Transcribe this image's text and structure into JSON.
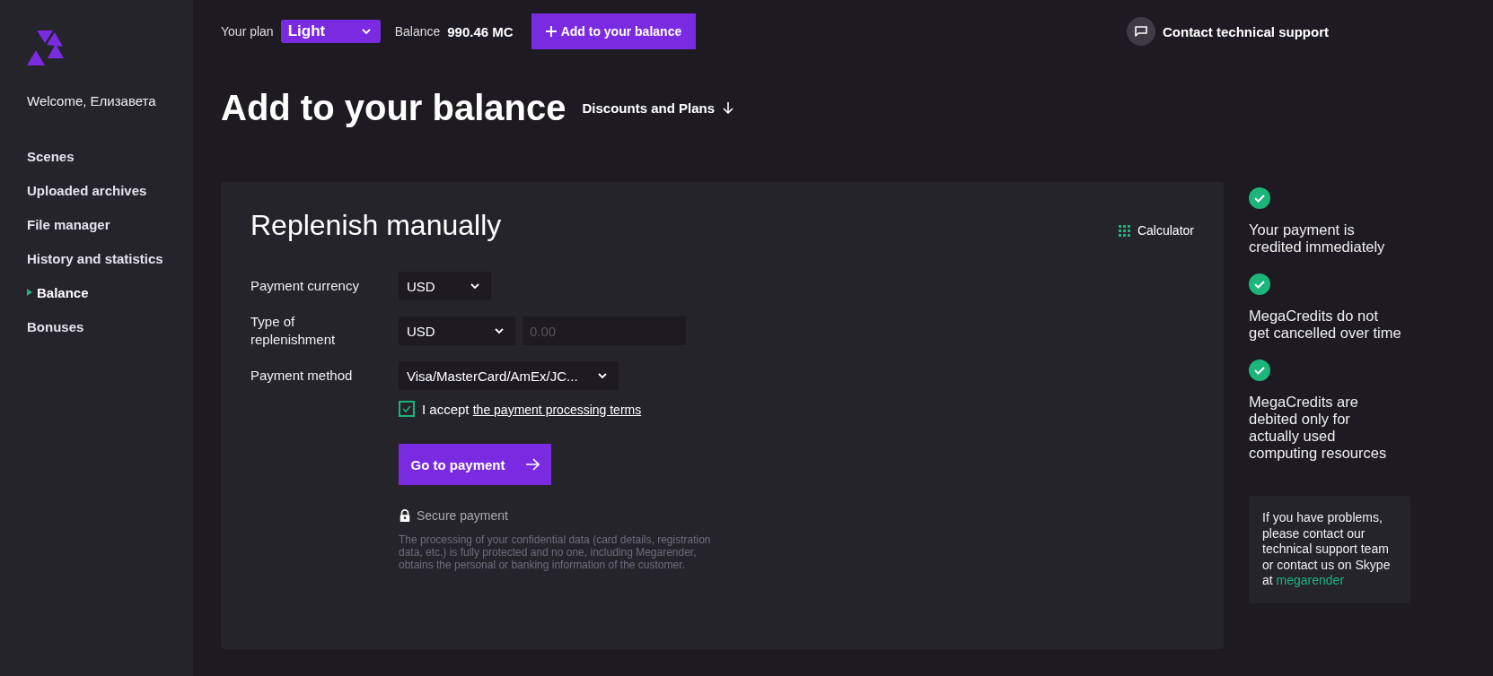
{
  "sidebar": {
    "welcome": "Welcome, Елизавета",
    "items": [
      {
        "label": "Scenes",
        "selected": false
      },
      {
        "label": "Uploaded archives",
        "selected": false
      },
      {
        "label": "File manager",
        "selected": false
      },
      {
        "label": "History and statistics",
        "selected": false
      },
      {
        "label": "Balance",
        "selected": true
      },
      {
        "label": "Bonuses",
        "selected": false
      }
    ]
  },
  "topbar": {
    "plan_label": "Your plan",
    "plan": "Light",
    "balance_label": "Balance",
    "balance": "990.46 MC",
    "add_button": "Add to your balance",
    "support": "Contact technical support"
  },
  "page": {
    "title": "Add to your balance",
    "plans_link": "Discounts and Plans"
  },
  "card": {
    "title": "Replenish manually",
    "calculator": "Calculator",
    "fields": [
      {
        "label": "Payment currency",
        "kind": "select",
        "value": "USD"
      },
      {
        "label": "Type of replenishment",
        "kind": "select-amount",
        "value": "USD",
        "placeholder": "0.00"
      },
      {
        "label": "Payment method",
        "kind": "select",
        "value": "Visa/MasterCard/AmEx/JC..."
      }
    ],
    "terms": {
      "checked": true,
      "text": "I accept",
      "link": "the payment processing terms"
    },
    "submit": "Go to payment",
    "secure": "Secure payment",
    "note": "The processing of your confidential data (card details, registration data, etc.) is fully protected and no one, including Megarender, obtains the personal or banking information of the customer."
  },
  "benefits": [
    "Your payment is credited immediately",
    "MegaCredits do not get cancelled over time",
    "MegaCredits are debited only for actually used computing resources"
  ],
  "help": {
    "text": "If you have problems, please contact our technical support team or contact us on Skype at",
    "link": "megarender"
  }
}
